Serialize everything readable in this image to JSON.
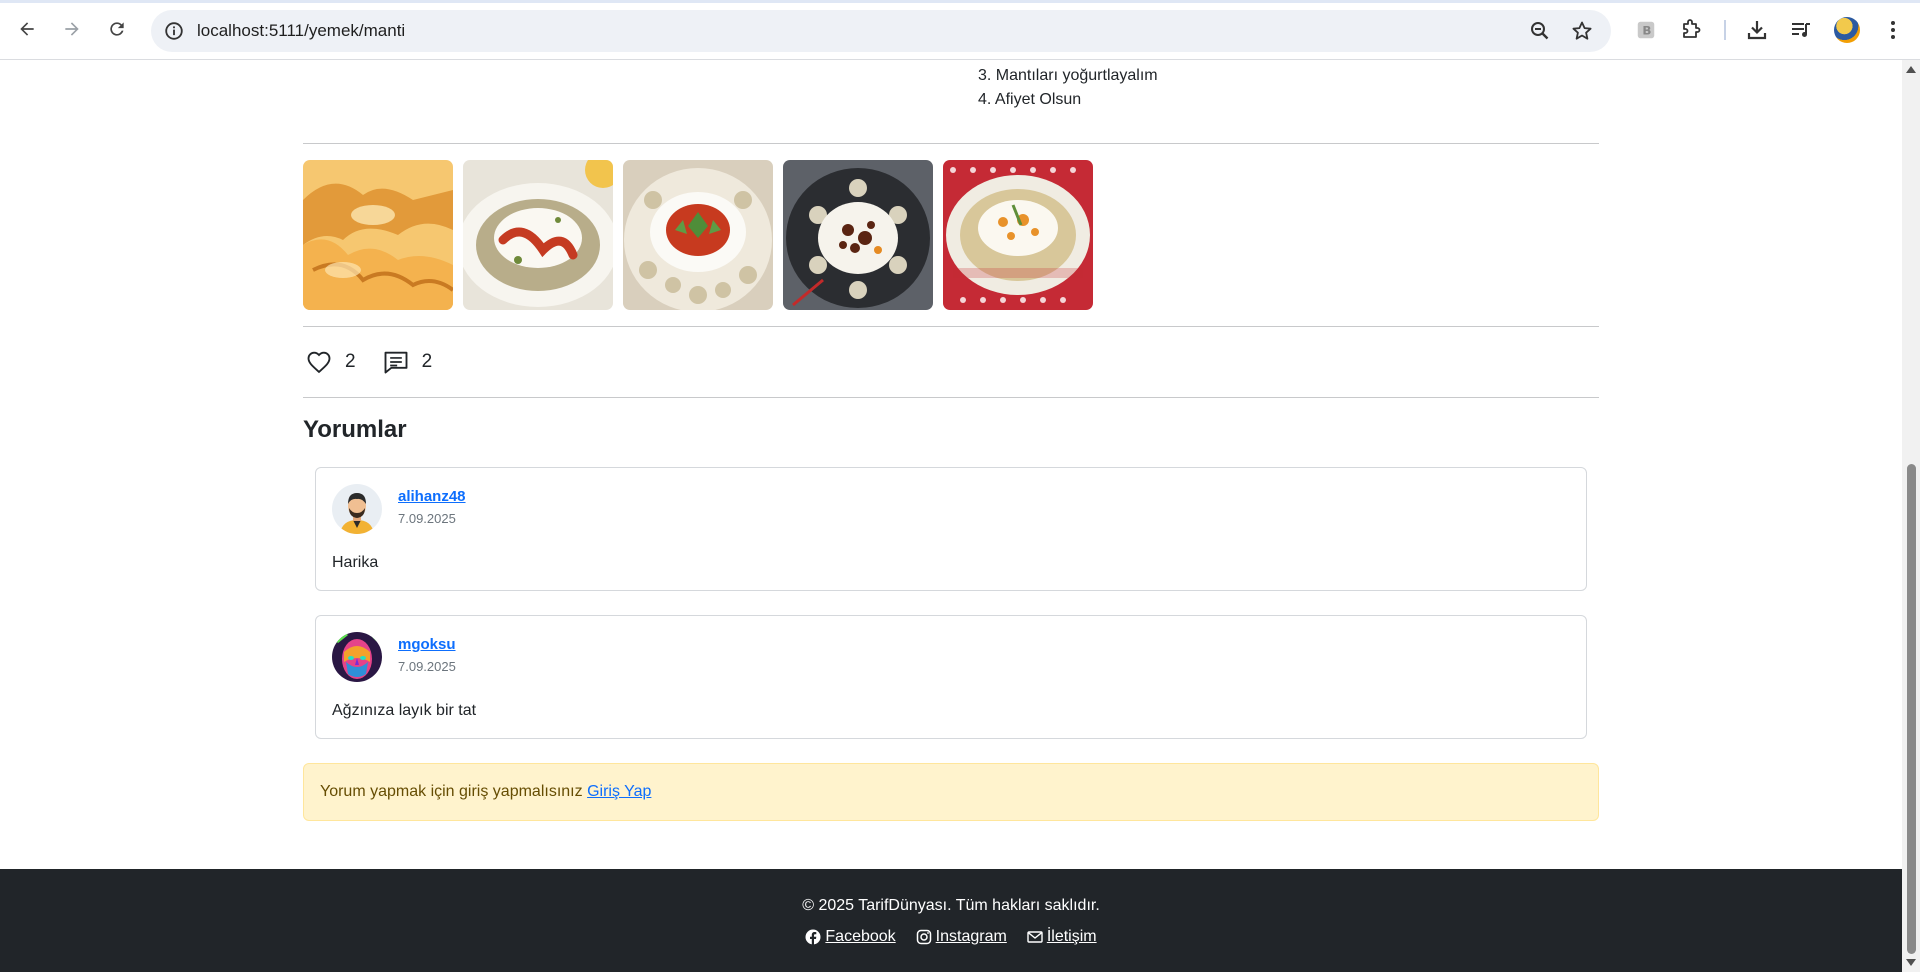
{
  "browser": {
    "url": "localhost:5111/yemek/manti",
    "icons": [
      "back-icon",
      "forward-icon",
      "reload-icon",
      "site-info-icon",
      "zoom-icon",
      "bookmark-star-icon",
      "extension-b-icon",
      "extensions-puzzle-icon",
      "download-icon",
      "media-queue-icon",
      "profile-avatar",
      "menu-kebab-icon"
    ]
  },
  "recipe": {
    "steps": [
      "3. Mantıları yoğurtlayalım",
      "4. Afiyet Olsun"
    ],
    "gallery": [
      {
        "name": "manti-photo-1",
        "colors": [
          "#f2b450",
          "#d9852a",
          "#fbe3a4"
        ]
      },
      {
        "name": "manti-photo-2",
        "colors": [
          "#f3f0e6",
          "#c94a2c",
          "#8c9a5b"
        ]
      },
      {
        "name": "manti-photo-3",
        "colors": [
          "#efece3",
          "#c83a22",
          "#4e8a3c"
        ]
      },
      {
        "name": "manti-photo-4",
        "colors": [
          "#3b3d42",
          "#f4f1e8",
          "#5a2c1b"
        ]
      },
      {
        "name": "manti-photo-5",
        "colors": [
          "#c92a36",
          "#f5efe0",
          "#e8922a"
        ]
      }
    ],
    "likes": "2",
    "comments_count": "2"
  },
  "comments_section": {
    "title": "Yorumlar",
    "comments": [
      {
        "username": "alihanz48",
        "date": "7.09.2025",
        "text": "Harika"
      },
      {
        "username": "mgoksu",
        "date": "7.09.2025",
        "text": "Ağzınıza layık bir tat"
      }
    ],
    "login_prompt": "Yorum yapmak için giriş yapmalısınız",
    "login_link": "Giriş Yap"
  },
  "footer": {
    "copyright": "© 2025 TarifDünyası. Tüm hakları saklıdır.",
    "links": [
      "Facebook",
      "Instagram",
      "İletişim"
    ]
  },
  "colors": {
    "link": "#0d6efd",
    "footer_bg": "#212529",
    "alert_bg": "#fff3cd",
    "alert_text": "#664d03"
  }
}
